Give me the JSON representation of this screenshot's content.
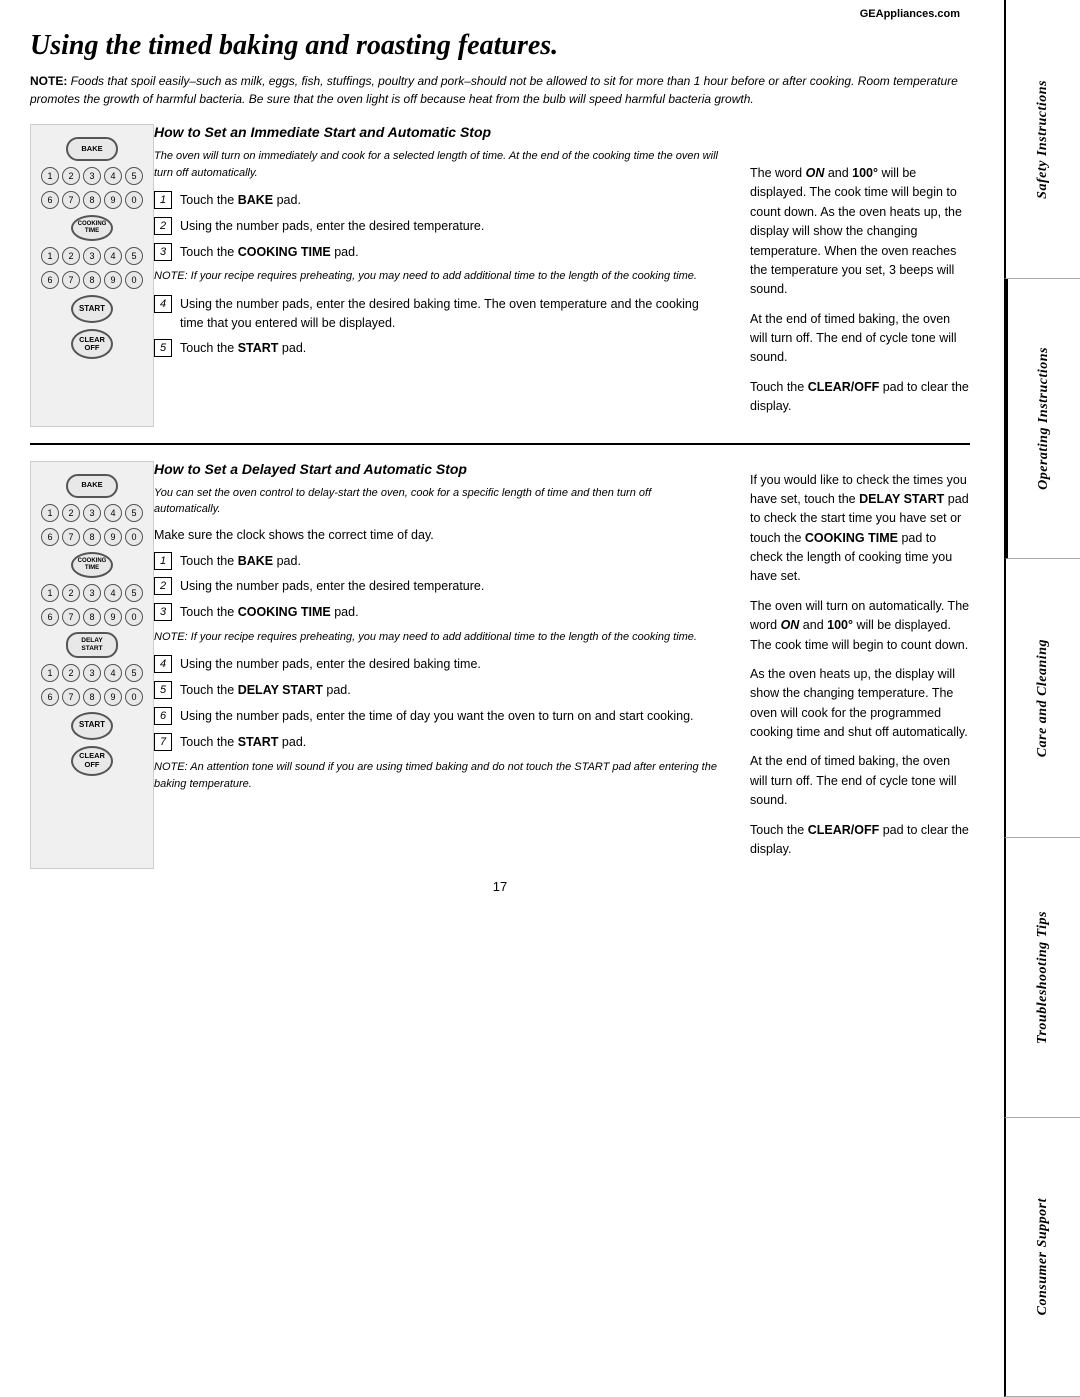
{
  "page": {
    "title": "Using the timed baking and roasting features.",
    "website": "GEAppliances.com",
    "note_intro": "NOTE:",
    "note_text": " Foods that spoil easily–such as milk, eggs, fish, stuffings, poultry and pork–should not be allowed to sit for more than 1 hour before or after cooking. Room temperature promotes the growth of harmful bacteria. Be sure that the oven light is off because heat from the bulb will speed harmful bacteria growth.",
    "page_number": "17"
  },
  "section1": {
    "heading": "How to Set an Immediate Start and Automatic Stop",
    "subtitle": "The oven will turn on immediately and cook for a selected length of time. At the end of the cooking time the oven will turn off automatically.",
    "steps": [
      {
        "num": "1",
        "text": "Touch the BAKE pad."
      },
      {
        "num": "2",
        "text": "Using the number pads, enter the desired temperature."
      },
      {
        "num": "3",
        "text": "Touch the COOKING TIME pad."
      },
      {
        "num": "4",
        "text": "Using the number pads, enter the desired baking time. The oven temperature and the cooking time that you entered will be displayed."
      },
      {
        "num": "5",
        "text": "Touch the START pad."
      }
    ],
    "note_between": "NOTE: If your recipe requires preheating, you may need to add additional time to the length of the cooking time.",
    "right_paragraphs": [
      "The word ON and 100° will be displayed. The cook time will begin to count down. As the oven heats up, the display will show the changing temperature. When the oven reaches the temperature you set, 3 beeps will sound.",
      "At the end of timed baking, the oven will turn off. The end of cycle tone will sound.",
      "Touch the CLEAR/OFF pad to clear the display."
    ]
  },
  "section2": {
    "heading": "How to Set a Delayed Start and Automatic Stop",
    "subtitle": "You can set the oven control to delay-start the oven, cook for a specific length of time and then turn off automatically.",
    "intro": "Make sure the clock shows the correct time of day.",
    "steps": [
      {
        "num": "1",
        "text": "Touch the BAKE pad."
      },
      {
        "num": "2",
        "text": "Using the number pads, enter the desired temperature."
      },
      {
        "num": "3",
        "text": "Touch the COOKING TIME pad."
      },
      {
        "num": "4",
        "text": "Using the number pads, enter the desired baking time."
      },
      {
        "num": "5",
        "text": "Touch the DELAY START pad."
      },
      {
        "num": "6",
        "text": "Using the number pads, enter the time of day you want the oven to turn on and start cooking."
      },
      {
        "num": "7",
        "text": "Touch the START pad."
      }
    ],
    "note_between": "NOTE: If your recipe requires preheating, you may need to add additional time to the length of the cooking time.",
    "note_end": "NOTE: An attention tone will sound if you are using timed baking and do not touch the START pad after entering the baking temperature.",
    "right_paragraphs": [
      "If you would like to check the times you have set, touch the DELAY START pad to check the start time you have set or touch the COOKING TIME pad to check the length of cooking time you have set.",
      "The oven will turn on automatically. The word ON and 100° will be displayed. The cook time will begin to count down.",
      "As the oven heats up, the display will show the changing temperature. The oven will cook for the programmed cooking time and shut off automatically.",
      "At the end of timed baking, the oven will turn off. The end of cycle tone will sound.",
      "Touch the CLEAR/OFF pad to clear the display."
    ]
  },
  "side_tabs": [
    "Safety Instructions",
    "Operating Instructions",
    "Care and Cleaning",
    "Troubleshooting Tips",
    "Consumer Support"
  ],
  "oven_panel1": {
    "bake": "BAKE",
    "cooking_time": "COOKING TIME",
    "start": "START",
    "clear_off": "CLEAR OFF"
  },
  "oven_panel2": {
    "bake": "BAKE",
    "cooking_time": "COOKING TIME",
    "delay_start": "DELAY START",
    "start": "START",
    "clear_off": "CLEAR OFF"
  }
}
